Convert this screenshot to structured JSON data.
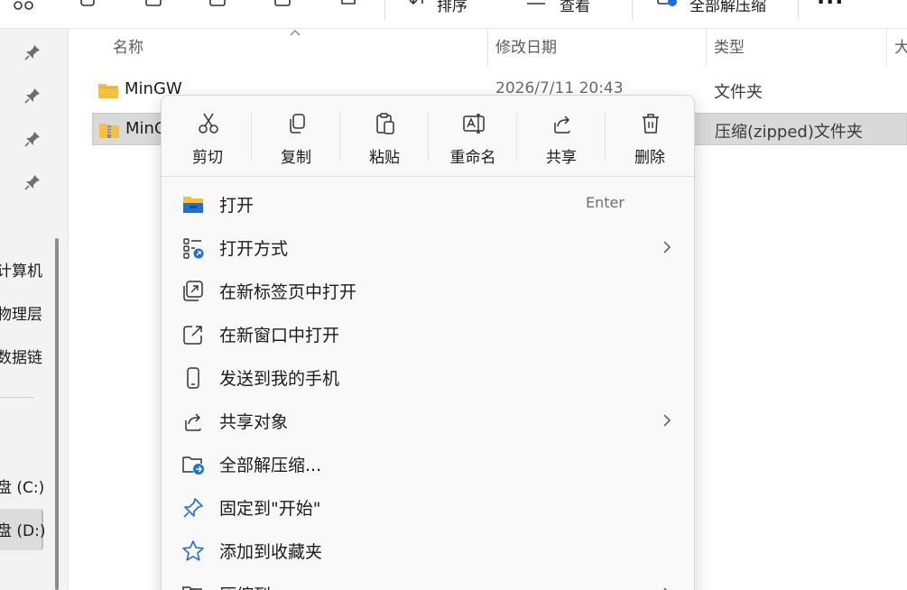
{
  "toolbar": {
    "sort_label": "排序",
    "view_label": "查看",
    "extract_label": "全部解压缩",
    "more_label": "···"
  },
  "nav": {
    "items": [
      "计算机",
      "物理层",
      "数据链"
    ],
    "drives": [
      "盘 (C:)",
      "盘 (D:)"
    ]
  },
  "list": {
    "columns": [
      "名称",
      "修改日期",
      "类型",
      "大"
    ],
    "rows": [
      {
        "name": "MinGW",
        "date": "2026/7/11 20:43",
        "type": "文件夹"
      },
      {
        "name": "MinG",
        "date": "",
        "type": "压缩(zipped)文件夹"
      }
    ]
  },
  "context_menu": {
    "quick_actions": [
      {
        "label": "剪切",
        "icon": "scissors-icon"
      },
      {
        "label": "复制",
        "icon": "copy-icon"
      },
      {
        "label": "粘贴",
        "icon": "paste-icon"
      },
      {
        "label": "重命名",
        "icon": "rename-icon"
      },
      {
        "label": "共享",
        "icon": "share-icon"
      },
      {
        "label": "删除",
        "icon": "trash-icon"
      }
    ],
    "items": [
      {
        "label": "打开",
        "shortcut": "Enter",
        "icon": "folder-open-icon"
      },
      {
        "label": "打开方式",
        "icon": "open-with-icon"
      },
      {
        "label": "在新标签页中打开",
        "icon": "new-tab-icon"
      },
      {
        "label": "在新窗口中打开",
        "icon": "new-window-icon"
      },
      {
        "label": "发送到我的手机",
        "icon": "phone-icon"
      },
      {
        "label": "共享对象",
        "icon": "share-icon"
      },
      {
        "label": "全部解压缩...",
        "icon": "extract-icon"
      },
      {
        "label": "固定到\"开始\"",
        "icon": "pin-icon"
      },
      {
        "label": "添加到收藏夹",
        "icon": "star-icon"
      },
      {
        "label": "压缩到",
        "icon": "compress-icon"
      }
    ]
  },
  "colors": {
    "accent": "#1e6fd6",
    "folder": "#f4c042",
    "selection": "#d9d9d9"
  }
}
